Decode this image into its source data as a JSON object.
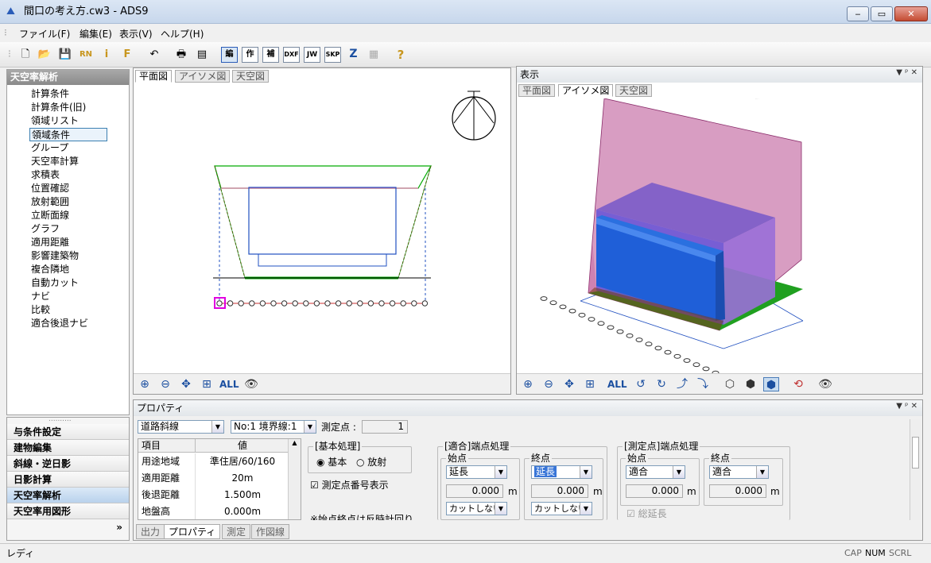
{
  "window": {
    "title": "間口の考え方.cw3 - ADS9",
    "min": "▭",
    "max": "▢",
    "close": "✕"
  },
  "menu": [
    "ファイル(F)",
    "編集(E)",
    "表示(V)",
    "ヘルプ(H)"
  ],
  "toolbar": {
    "labels": [
      "編",
      "作",
      "補",
      "DXF",
      "JW",
      "SKP",
      "Z"
    ]
  },
  "left_panel": {
    "header": "天空率解析",
    "items": [
      "計算条件",
      "計算条件(旧)",
      "領域リスト",
      "領域条件",
      "グループ",
      "天空率計算",
      "求積表",
      "位置確認",
      "放射範囲",
      "立断面線",
      "グラフ",
      "適用距離",
      "影響建築物",
      "複合隣地",
      "自動カット",
      "ナビ",
      "比較",
      "適合後退ナビ"
    ],
    "selected": "領域条件"
  },
  "nav": {
    "grip": "..........",
    "items": [
      "与条件設定",
      "建物編集",
      "斜線・逆日影",
      "日影計算",
      "天空率解析",
      "天空率用図形"
    ],
    "active": "天空率解析",
    "more": "»"
  },
  "left_view": {
    "tabs": [
      "平面図",
      "アイソメ図",
      "天空図"
    ],
    "zoom_all": "ALL"
  },
  "right_view": {
    "title": "表示",
    "tabs": [
      "平面図",
      "アイソメ図",
      "天空図"
    ],
    "zoom_all": "ALL",
    "ctl": "▼ ᵖ ✕"
  },
  "props": {
    "title": "プロパティ",
    "ctl": "▼ ᵖ ✕",
    "type_select": "道路斜線",
    "boundary_select": "No:1 境界線:1",
    "point_label": "測定点 :",
    "point_value": "1",
    "table": {
      "headers": [
        "項目",
        "値"
      ],
      "rows": [
        [
          "用途地域",
          "準住居/60/160"
        ],
        [
          "適用距離",
          "20m"
        ],
        [
          "後退距離",
          "1.500m"
        ],
        [
          "地盤高",
          "0.000m"
        ]
      ]
    },
    "basic": {
      "title": "[基本処理]",
      "opt1": "基本",
      "opt2": "放射",
      "check": "測定点番号表示",
      "note": "※始点終点は反時計回り"
    },
    "fit": {
      "title": "[適合]端点処理",
      "start": "始点",
      "end": "終点",
      "start_select": "延長",
      "end_select": "延長",
      "start_value": "0.000",
      "end_value": "0.000",
      "unit": "m",
      "start_cut": "カットしない",
      "end_cut": "カットしない"
    },
    "meas": {
      "title": "[測定点]端点処理",
      "start": "始点",
      "end": "終点",
      "start_select": "適合",
      "end_select": "適合",
      "start_value": "0.000",
      "end_value": "0.000",
      "unit": "m",
      "check": "総延長"
    }
  },
  "bottom_tabs": [
    "出力",
    "プロパティ",
    "測定",
    "作図線"
  ],
  "bottom_active": "プロパティ",
  "status": {
    "text": "レディ",
    "cap": "CAP",
    "num": "NUM",
    "scrl": "SCRL"
  }
}
